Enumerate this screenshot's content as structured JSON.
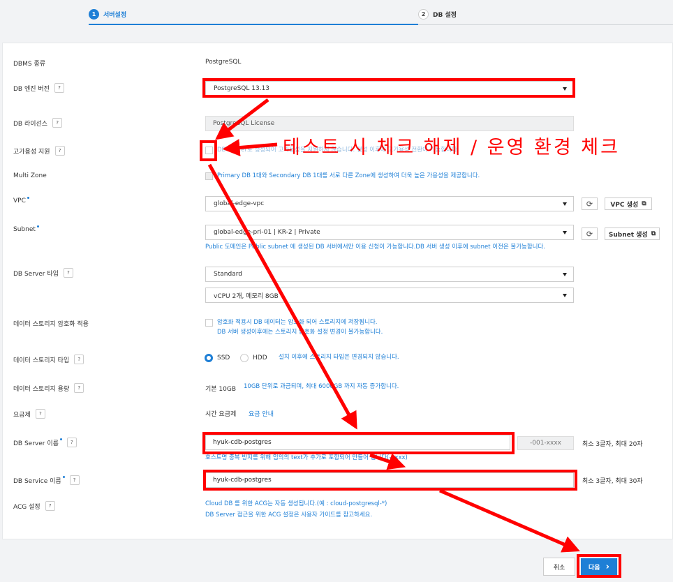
{
  "steps": [
    {
      "num": "1",
      "label": "서버설정"
    },
    {
      "num": "2",
      "label": "DB 설정"
    }
  ],
  "form": {
    "dbms_type": {
      "label": "DBMS 종류",
      "value": "PostgreSQL"
    },
    "engine_version": {
      "label": "DB 엔진 버전",
      "value": "PostgreSQL 13.13"
    },
    "license": {
      "label": "DB 라이선스",
      "value": "PostgreSQL License"
    },
    "ha": {
      "label": "고가용성 지원",
      "hint": "DB Server로 생성되어 고가용성을 지원하지 않습니다. 생성 이후에 고가용성 전환이 가능합니다."
    },
    "multizone": {
      "label": "Multi Zone",
      "hint": "Primary DB 1대와 Secondary DB 1대를 서로 다른 Zone에 생성하여 더욱 높은 가용성을 제공합니다."
    },
    "vpc": {
      "label": "VPC",
      "value": "global-edge-vpc",
      "button": "VPC 생성"
    },
    "subnet": {
      "label": "Subnet",
      "value": "global-edge-pri-01 | KR-2 | Private",
      "button": "Subnet 생성",
      "hint": "Public 도메인은 Public subnet 에 생성된 DB 서버에서만 이용 신청이 가능합니다.DB 서버 생성 이후에 subnet 이전은 불가능합니다."
    },
    "server_type": {
      "label": "DB Server 타입",
      "value1": "Standard",
      "value2": "vCPU 2개, 메모리 8GB"
    },
    "encryption": {
      "label": "데이터 스토리지 암호화 적용",
      "hint1": "암호화 적용시 DB 데이터는 암호화 되어 스토리지에 저장됩니다.",
      "hint2": "DB 서버 생성이후에는 스토리지 암호화 설정 변경이 불가능합니다."
    },
    "storage_type": {
      "label": "데이터 스토리지 타입",
      "opt1": "SSD",
      "opt2": "HDD",
      "hint": "설치 이후에 스토리지 타입은 변경되지 않습니다."
    },
    "storage_size": {
      "label": "데이터 스토리지 용량",
      "value": "기본 10GB",
      "hint": "10GB 단위로 과금되며, 최대 6000GB 까지 자동 증가합니다."
    },
    "billing": {
      "label": "요금제",
      "value": "시간 요금제",
      "link": "요금 안내"
    },
    "server_name": {
      "label": "DB Server 이름",
      "value": "hyuk-cdb-postgres",
      "suffix": "-001-xxxx",
      "limit": "최소 3글자, 최대 20자",
      "hint": "호스트명 중복 방지를 위해 임의의 text가 추가로 포함되어 만들어 집니다(-xxxx)"
    },
    "service_name": {
      "label": "DB Service 이름",
      "value": "hyuk-cdb-postgres",
      "limit": "최소 3글자, 최대 30자"
    },
    "acg": {
      "label": "ACG 설정",
      "hint1": "Cloud DB 를 위한 ACG는 자동 생성됩니다.(예 : cloud-postgresql-*)",
      "hint2": "DB Server 접근을 위한 ACG 설정은 사용자 가이드를 참고하세요."
    }
  },
  "icons": {
    "help": "?",
    "refresh": "⟳",
    "external": "⧉",
    "next": "›"
  },
  "buttons": {
    "cancel": "취소",
    "next": "다음"
  },
  "annotation": {
    "text": "테스트 시 체크 해제 / 운영 환경 체크",
    "color": "#ff0000"
  },
  "colors": {
    "accent": "#1e7fd6",
    "annotation": "#ff0000"
  }
}
